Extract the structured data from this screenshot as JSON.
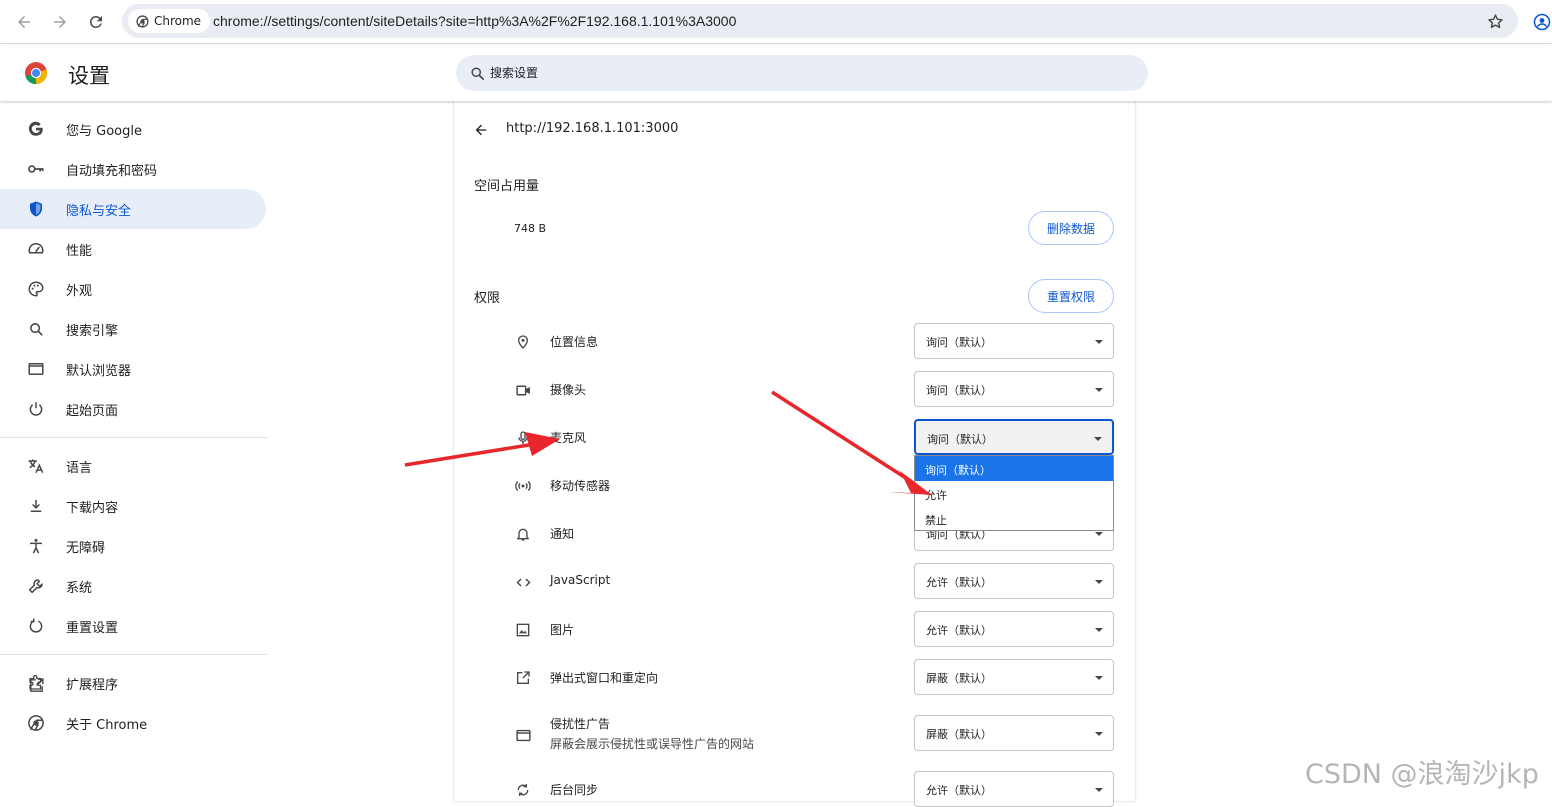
{
  "browser": {
    "chip_label": "Chrome",
    "url": "chrome://settings/content/siteDetails?site=http%3A%2F%2F192.168.1.101%3A3000"
  },
  "header": {
    "title": "设置",
    "search_placeholder": "搜索设置"
  },
  "sidebar": {
    "items": [
      {
        "label": "您与 Google",
        "icon": "google-g-icon"
      },
      {
        "label": "自动填充和密码",
        "icon": "key-icon"
      },
      {
        "label": "隐私与安全",
        "icon": "shield-icon",
        "active": true
      },
      {
        "label": "性能",
        "icon": "speedometer-icon"
      },
      {
        "label": "外观",
        "icon": "palette-icon"
      },
      {
        "label": "搜索引擎",
        "icon": "search-icon"
      },
      {
        "label": "默认浏览器",
        "icon": "browser-window-icon"
      },
      {
        "label": "起始页面",
        "icon": "power-icon"
      },
      {
        "label": "语言",
        "icon": "translate-icon"
      },
      {
        "label": "下载内容",
        "icon": "download-icon"
      },
      {
        "label": "无障碍",
        "icon": "accessibility-icon"
      },
      {
        "label": "系统",
        "icon": "wrench-icon"
      },
      {
        "label": "重置设置",
        "icon": "reset-icon"
      },
      {
        "label": "扩展程序",
        "icon": "puzzle-icon"
      },
      {
        "label": "关于 Chrome",
        "icon": "chrome-icon"
      }
    ]
  },
  "site": {
    "title": "http://192.168.1.101:3000",
    "usage_label": "空间占用量",
    "usage_value": "748 B",
    "delete_button": "删除数据",
    "permissions_label": "权限",
    "reset_button": "重置权限"
  },
  "permissions": [
    {
      "label": "位置信息",
      "value": "询问（默认）",
      "icon": "location-pin-icon"
    },
    {
      "label": "摄像头",
      "value": "询问（默认）",
      "icon": "camera-icon"
    },
    {
      "label": "麦克风",
      "value": "询问（默认）",
      "icon": "microphone-icon",
      "focused": true
    },
    {
      "label": "移动传感器",
      "value": "询问（默认）",
      "icon": "sensor-icon"
    },
    {
      "label": "通知",
      "value": "询问（默认）",
      "icon": "bell-icon"
    },
    {
      "label": "JavaScript",
      "value": "允许（默认）",
      "icon": "code-icon"
    },
    {
      "label": "图片",
      "value": "允许（默认）",
      "icon": "image-icon"
    },
    {
      "label": "弹出式窗口和重定向",
      "value": "屏蔽（默认）",
      "icon": "open-in-new-icon"
    },
    {
      "label": "侵扰性广告",
      "sublabel": "屏蔽会展示侵扰性或误导性广告的网站",
      "value": "屏蔽（默认）",
      "icon": "ad-window-icon"
    },
    {
      "label": "后台同步",
      "value": "允许（默认）",
      "icon": "sync-icon"
    }
  ],
  "dropdown_options": [
    "询问（默认）",
    "允许",
    "禁止"
  ],
  "watermark": "CSDN @浪淘沙jkp",
  "colors": {
    "accent": "#0b57d0",
    "annotation_arrow": "#e8262b",
    "selected_option": "#1a73e8"
  }
}
